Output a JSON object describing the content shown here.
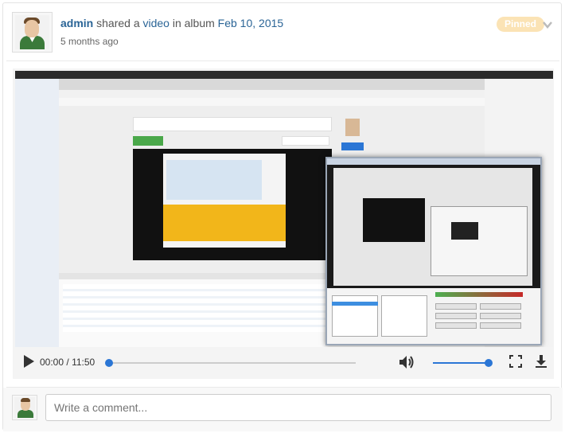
{
  "post": {
    "user": "admin",
    "action_text": "shared a",
    "object_link": "video",
    "in_text": "in album",
    "album_link": "Feb 10, 2015",
    "time_ago": "5 months ago",
    "pinned_label": "Pinned"
  },
  "player": {
    "current_time": "00:00",
    "separator": "/",
    "duration": "11:50",
    "progress_fraction": 0.0,
    "volume_fraction": 1.0
  },
  "comment": {
    "placeholder": "Write a comment..."
  },
  "colors": {
    "link": "#2a6496",
    "pinned_bg": "#fbe3b5",
    "accent": "#2b76d5"
  }
}
